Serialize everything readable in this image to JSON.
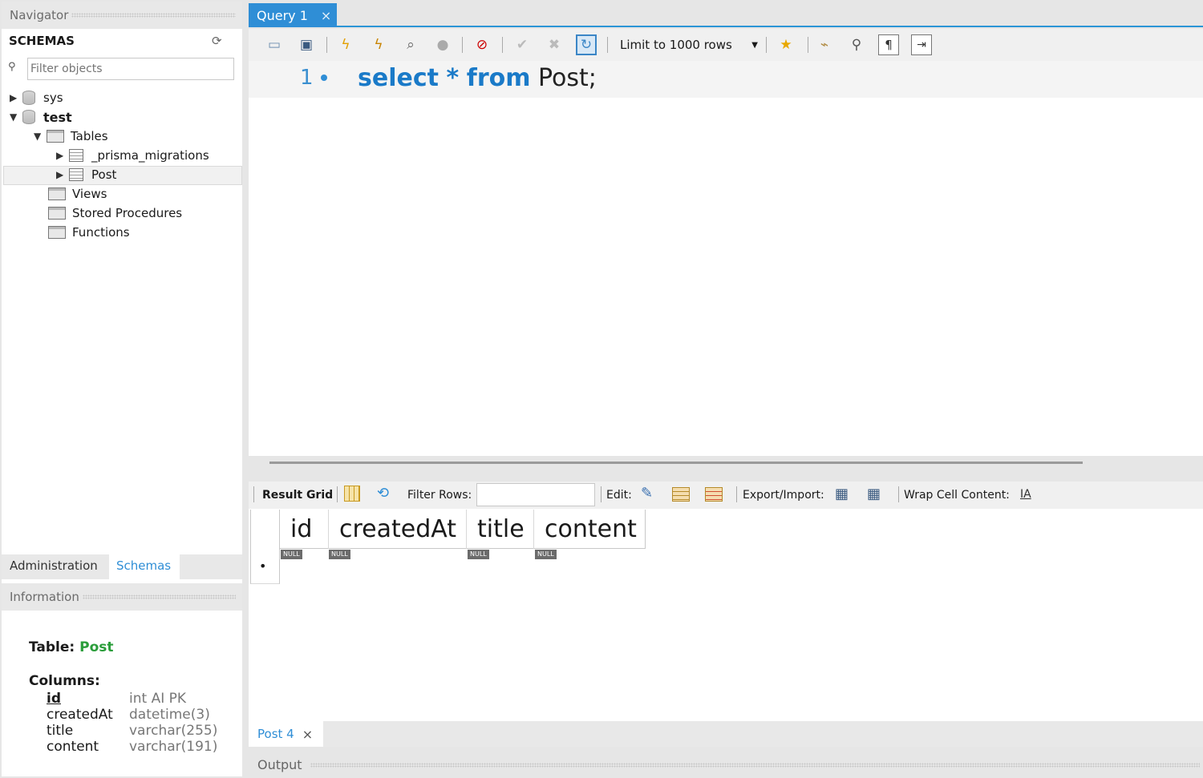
{
  "navigator": {
    "title": "Navigator",
    "schemas_label": "SCHEMAS",
    "filter_placeholder": "Filter objects",
    "tree": {
      "sys": "sys",
      "test": "test",
      "tables": "Tables",
      "prisma": "_prisma_migrations",
      "post": "Post",
      "views": "Views",
      "procedures": "Stored Procedures",
      "functions": "Functions"
    },
    "tabs": {
      "admin": "Administration",
      "schemas": "Schemas"
    }
  },
  "information": {
    "title": "Information",
    "table_label": "Table:",
    "table_name": "Post",
    "columns_label": "Columns:",
    "columns": [
      {
        "name": "id",
        "type": "int AI PK"
      },
      {
        "name": "createdAt",
        "type": "datetime(3)"
      },
      {
        "name": "title",
        "type": "varchar(255)"
      },
      {
        "name": "content",
        "type": "varchar(191)"
      }
    ]
  },
  "query_tab": {
    "label": "Query 1",
    "close": "×"
  },
  "toolbar": {
    "limit": "Limit to 1000 rows"
  },
  "editor": {
    "line_no": "1",
    "kw_select": "select",
    "star": "*",
    "kw_from": "from",
    "table": "Post;"
  },
  "resultbar": {
    "result_grid": "Result Grid",
    "filter_rows": "Filter Rows:",
    "edit": "Edit:",
    "export": "Export/Import:",
    "wrap": "Wrap Cell Content:"
  },
  "grid": {
    "columns": [
      "id",
      "createdAt",
      "title",
      "content"
    ],
    "null_text": "NULL",
    "row_marker": "•"
  },
  "result_tab": {
    "label": "Post 4",
    "close": "×"
  },
  "output": {
    "title": "Output"
  },
  "colors": {
    "accent": "#2f8ed6",
    "keyword": "#1a7ac8",
    "green": "#2a9d3a"
  }
}
